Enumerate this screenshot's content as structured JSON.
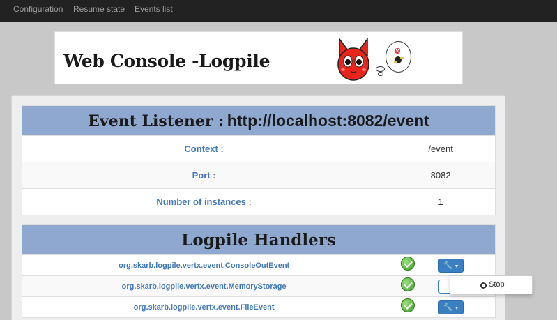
{
  "nav": {
    "items": [
      "Configuration",
      "Resume state",
      "Events list"
    ]
  },
  "banner": {
    "title": "Web Console -Logpile"
  },
  "listener": {
    "title_bold": "Event Listener :",
    "url": "http://localhost:8082/event",
    "rows": [
      {
        "label": "Context :",
        "value": "/event"
      },
      {
        "label": "Port :",
        "value": "8082"
      },
      {
        "label": "Number of instances :",
        "value": "1"
      }
    ]
  },
  "handlers": {
    "title": "Logpile Handlers",
    "items": [
      {
        "name": "org.skarb.logpile.vertx.event.ConsoleOutEvent",
        "status": "ok"
      },
      {
        "name": "org.skarb.logpile.vertx.event.MemoryStorage",
        "status": "ok"
      },
      {
        "name": "org.skarb.logpile.vertx.event.FileEvent",
        "status": "ok"
      }
    ]
  },
  "dropdown": {
    "stop_label": "Stop"
  },
  "colors": {
    "navbar": "#222222",
    "nav_text": "#9d9d9d",
    "header_bg": "#8fa8cf",
    "label_blue": "#4178b5",
    "button_blue": "#3a7fc4",
    "cat_red": "#e8241b"
  }
}
